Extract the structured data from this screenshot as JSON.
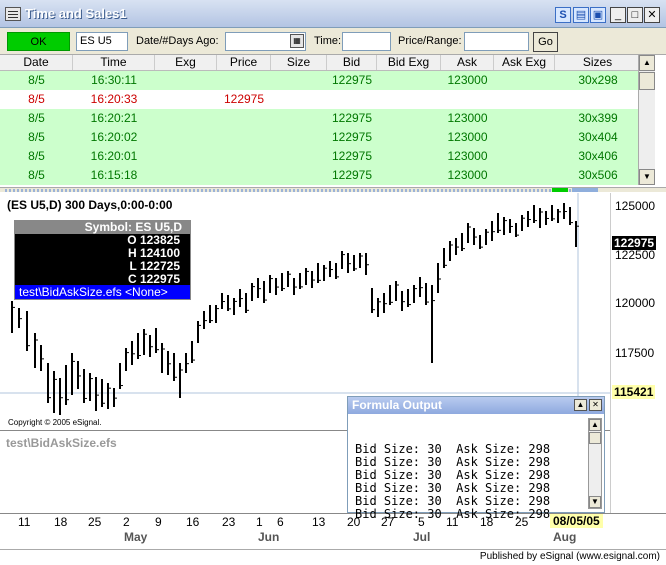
{
  "window": {
    "title": "Time and Sales1"
  },
  "toolbar": {
    "ok_label": "OK",
    "symbol_value": "ES U5",
    "date_label": "Date/#Days Ago:",
    "time_label": "Time:",
    "price_label": "Price/Range:",
    "go_label": "Go"
  },
  "grid": {
    "columns": [
      "Date",
      "Time",
      "Exg",
      "Price",
      "Size",
      "Bid",
      "Bid Exg",
      "Ask",
      "Ask Exg",
      "Sizes"
    ],
    "rows": [
      {
        "type": "bidask",
        "cells": [
          "8/5",
          "16:30:11",
          "",
          "",
          "",
          "122975",
          "",
          "123000",
          "",
          "30x298"
        ]
      },
      {
        "type": "trade",
        "cells": [
          "8/5",
          "16:20:33",
          "",
          "122975",
          "",
          "",
          "",
          "",
          "",
          ""
        ]
      },
      {
        "type": "bidask",
        "cells": [
          "8/5",
          "16:20:21",
          "",
          "",
          "",
          "122975",
          "",
          "123000",
          "",
          "30x399"
        ]
      },
      {
        "type": "bidask",
        "cells": [
          "8/5",
          "16:20:02",
          "",
          "",
          "",
          "122975",
          "",
          "123000",
          "",
          "30x404"
        ]
      },
      {
        "type": "bidask",
        "cells": [
          "8/5",
          "16:20:01",
          "",
          "",
          "",
          "122975",
          "",
          "123000",
          "",
          "30x406"
        ]
      },
      {
        "type": "bidask",
        "cells": [
          "8/5",
          "16:15:18",
          "",
          "",
          "",
          "122975",
          "",
          "123000",
          "",
          "30x506"
        ]
      }
    ]
  },
  "chart": {
    "title": "(ES U5,D) 300 Days,0:00-0:00",
    "ohlc": {
      "symbol": "Symbol: ES U5,D",
      "open": "O 123825",
      "high": "H 124100",
      "low": "L 122725",
      "close": "C 122975",
      "study": "test\\BidAskSize.efs <None>"
    },
    "copyright": "Copyright © 2005 eSignal.",
    "study_pane_label": "test\\BidAskSize.efs",
    "price_labels": [
      "125000",
      "122500",
      "120000",
      "117500"
    ],
    "last_price": "122975",
    "cursor_price": "115421",
    "date_labels": [
      "11",
      "18",
      "25",
      "2",
      "9",
      "16",
      "23",
      "1",
      "6",
      "13",
      "20",
      "27",
      "5",
      "11",
      "18",
      "25"
    ],
    "month_labels": [
      "May",
      "Jun",
      "Jul",
      "Aug"
    ],
    "cursor_date": "08/05/05",
    "colors": {
      "bars": "#000000",
      "grid": "#b0c4de",
      "cursor": "#ffffaa"
    }
  },
  "formula_output": {
    "title": "Formula Output",
    "lines": [
      "Bid Size: 30  Ask Size: 298",
      "Bid Size: 30  Ask Size: 298",
      "Bid Size: 30  Ask Size: 298",
      "Bid Size: 30  Ask Size: 298",
      "Bid Size: 30  Ask Size: 298",
      "Bid Size: 30  Ask Size: 298"
    ]
  },
  "status": {
    "text": "Published by eSignal (www.esignal.com)"
  }
}
